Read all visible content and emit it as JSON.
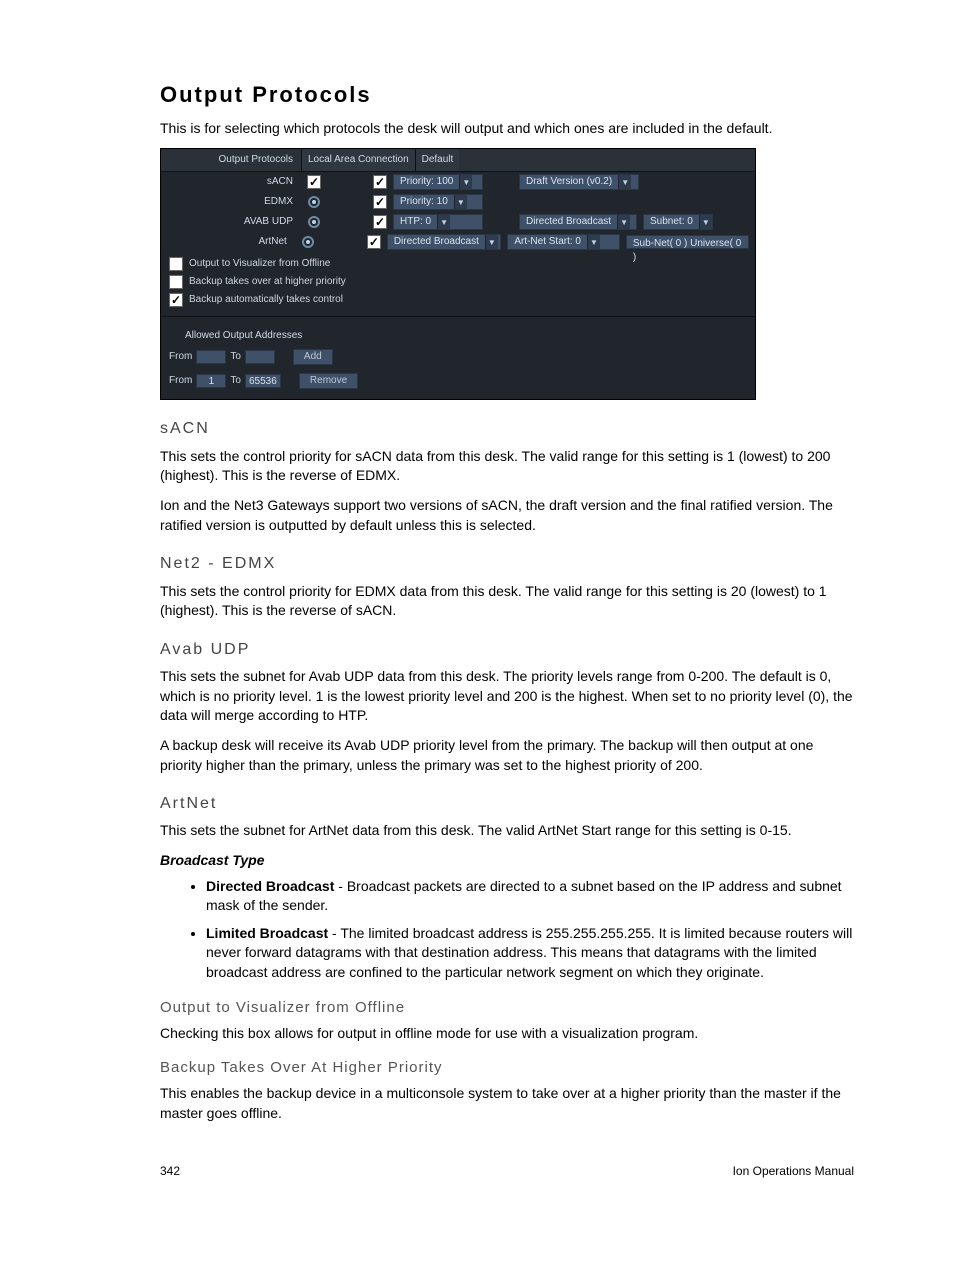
{
  "title": "Output Protocols",
  "intro": "This is for selecting which protocols the desk will output and which ones are included in the default.",
  "panel": {
    "headerLabel": "Output Protocols",
    "connection": "Local Area Connection",
    "defaultLabel": "Default",
    "sacn": {
      "label": "sACN",
      "priority": "Priority: 100",
      "draft": "Draft Version (v0.2)"
    },
    "edmx": {
      "label": "EDMX",
      "priority": "Priority: 10"
    },
    "avab": {
      "label": "AVAB UDP",
      "htp": "HTP: 0",
      "bcast": "Directed Broadcast",
      "subnet": "Subnet: 0"
    },
    "artnet": {
      "label": "ArtNet",
      "bcast": "Directed Broadcast",
      "start": "Art-Net Start: 0",
      "sub": "Sub-Net( 0 ) Universe( 0 )"
    },
    "viz": "Output to Visualizer from Offline",
    "backupHigh": "Backup takes over at higher priority",
    "backupAuto": "Backup automatically takes control",
    "addrTitle": "Allowed Output Addresses",
    "from": "From",
    "to": "To",
    "add": "Add",
    "remove": "Remove",
    "from2": "1",
    "to2": "65536"
  },
  "sections": {
    "sacn": {
      "h": "sACN",
      "p1": "This sets the control priority for sACN data from this desk. The valid range for this setting is 1 (lowest) to 200 (highest). This is the reverse of EDMX.",
      "p2": "Ion and the Net3 Gateways support two versions of sACN, the draft version and the final ratified version. The ratified version is outputted by default unless this is selected."
    },
    "net2": {
      "h": "Net2 - EDMX",
      "p": "This sets the control priority for EDMX data from this desk. The valid range for this setting is 20 (lowest) to 1 (highest). This is the reverse of sACN."
    },
    "avab": {
      "h": "Avab UDP",
      "p1": "This sets the subnet for Avab UDP data from this desk. The priority levels range from 0-200. The default is 0, which is no priority level. 1 is the lowest priority level and 200 is the highest. When set to no priority level (0), the data will merge according to HTP.",
      "p2": "A backup desk will receive its Avab UDP priority level from the primary. The backup will then output at one priority higher than the primary, unless the primary was set to the highest priority of 200."
    },
    "artnet": {
      "h": "ArtNet",
      "p": "This sets the subnet for ArtNet data from this desk. The valid ArtNet Start range for this setting is 0-15."
    },
    "bcast": {
      "h": "Broadcast Type",
      "b1": "Directed Broadcast",
      "t1": " - Broadcast packets are directed to a subnet based on the IP address and subnet mask of the sender.",
      "b2": "Limited Broadcast",
      "t2": " - The limited broadcast address is 255.255.255.255. It is limited because routers will never forward datagrams with that destination address. This means that datagrams with the limited broadcast address are confined to the particular network segment on which they originate."
    },
    "viz": {
      "h": "Output to Visualizer from Offline",
      "p": "Checking this box allows for output in offline mode for use with a visualization program."
    },
    "back": {
      "h": "Backup Takes Over At Higher Priority",
      "p": "This enables the backup device in a multiconsole system to take over at a higher priority than the master if the master goes offline."
    }
  },
  "footer": {
    "page": "342",
    "manual": "Ion Operations Manual"
  }
}
